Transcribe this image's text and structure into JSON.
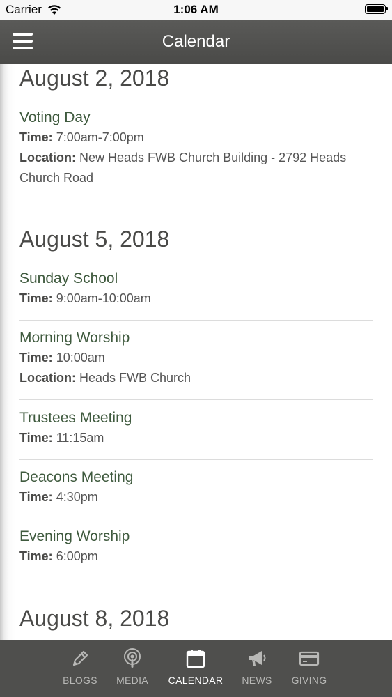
{
  "status_bar": {
    "carrier": "Carrier",
    "time": "1:06 AM"
  },
  "nav": {
    "title": "Calendar"
  },
  "days": [
    {
      "date": "August 2, 2018",
      "events": [
        {
          "name": "Voting Day",
          "time_label": "Time:",
          "time": "7:00am-7:00pm",
          "location_label": "Location:",
          "location_line1": "New Heads FWB Church Building - 2792 Heads",
          "location_line2": "Church Road"
        }
      ]
    },
    {
      "date": "August 5, 2018",
      "events": [
        {
          "name": "Sunday School",
          "time_label": "Time:",
          "time": "9:00am-10:00am"
        },
        {
          "name": "Morning Worship",
          "time_label": "Time:",
          "time": "10:00am",
          "location_label": "Location:",
          "location": "Heads FWB Church"
        },
        {
          "name": "Trustees Meeting",
          "time_label": "Time:",
          "time": "11:15am"
        },
        {
          "name": "Deacons Meeting",
          "time_label": "Time:",
          "time": "4:30pm"
        },
        {
          "name": "Evening Worship",
          "time_label": "Time:",
          "time": "6:00pm"
        }
      ]
    },
    {
      "date": "August 8, 2018",
      "events": []
    }
  ],
  "tabs": [
    {
      "label": "BLOGS",
      "icon": "pencil-icon"
    },
    {
      "label": "MEDIA",
      "icon": "podcast-icon"
    },
    {
      "label": "CALENDAR",
      "icon": "calendar-icon",
      "active": true
    },
    {
      "label": "NEWS",
      "icon": "megaphone-icon"
    },
    {
      "label": "GIVING",
      "icon": "credit-card-icon"
    }
  ]
}
